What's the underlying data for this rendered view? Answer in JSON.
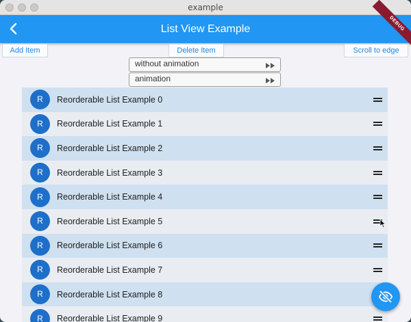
{
  "window": {
    "title": "example"
  },
  "appbar": {
    "title": "List View Example",
    "debug_banner": "DEBUG"
  },
  "toolbar": {
    "add_label": "Add Item",
    "delete_label": "Delete Item",
    "scroll_label": "Scroll to edge"
  },
  "animation_toggles": [
    {
      "label": "without animation"
    },
    {
      "label": "animation"
    }
  ],
  "list": {
    "items": [
      {
        "avatar": "R",
        "label": "Reorderable List Example 0"
      },
      {
        "avatar": "R",
        "label": "Reorderable List Example 1"
      },
      {
        "avatar": "R",
        "label": "Reorderable List Example 2"
      },
      {
        "avatar": "R",
        "label": "Reorderable List Example 3"
      },
      {
        "avatar": "R",
        "label": "Reorderable List Example 4"
      },
      {
        "avatar": "R",
        "label": "Reorderable List Example 5"
      },
      {
        "avatar": "R",
        "label": "Reorderable List Example 6"
      },
      {
        "avatar": "R",
        "label": "Reorderable List Example 7"
      },
      {
        "avatar": "R",
        "label": "Reorderable List Example 8"
      },
      {
        "avatar": "R",
        "label": "Reorderable List Example 9"
      }
    ]
  },
  "fab": {
    "icon": "visibility-off-icon"
  },
  "colors": {
    "primary": "#2196f3",
    "avatar": "#1e6fc9",
    "row_even": "#cfe0f0",
    "row_odd": "#e9edf2"
  }
}
